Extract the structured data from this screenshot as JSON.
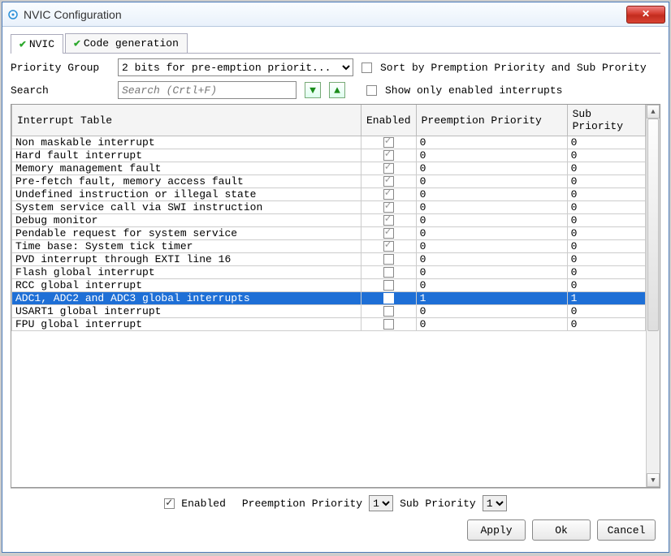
{
  "window": {
    "title": "NVIC Configuration"
  },
  "tabs": {
    "nvic": "NVIC",
    "codegen": "Code generation"
  },
  "priority_group": {
    "label": "Priority Group",
    "value": "2 bits for pre-emption priorit..."
  },
  "sort_checkbox": "Sort by Premption Priority and Sub Prority",
  "search": {
    "label": "Search",
    "placeholder": "Search (Crtl+F)"
  },
  "show_enabled": "Show only enabled interrupts",
  "columns": {
    "c0": "Interrupt Table",
    "c1": "Enabled",
    "c2": "Preemption Priority",
    "c3": "Sub Priority"
  },
  "rows": [
    {
      "name": "Non maskable interrupt",
      "en": true,
      "lock": true,
      "pre": "0",
      "sub": "0"
    },
    {
      "name": "Hard fault interrupt",
      "en": true,
      "lock": true,
      "pre": "0",
      "sub": "0"
    },
    {
      "name": "Memory management fault",
      "en": true,
      "lock": true,
      "pre": "0",
      "sub": "0"
    },
    {
      "name": "Pre-fetch fault, memory access fault",
      "en": true,
      "lock": true,
      "pre": "0",
      "sub": "0"
    },
    {
      "name": "Undefined instruction or illegal state",
      "en": true,
      "lock": true,
      "pre": "0",
      "sub": "0"
    },
    {
      "name": "System service call via SWI instruction",
      "en": true,
      "lock": true,
      "pre": "0",
      "sub": "0"
    },
    {
      "name": "Debug monitor",
      "en": true,
      "lock": true,
      "pre": "0",
      "sub": "0"
    },
    {
      "name": "Pendable request for system service",
      "en": true,
      "lock": true,
      "pre": "0",
      "sub": "0"
    },
    {
      "name": "Time base: System tick timer",
      "en": true,
      "lock": true,
      "pre": "0",
      "sub": "0"
    },
    {
      "name": "PVD interrupt through EXTI line 16",
      "en": false,
      "lock": false,
      "pre": "0",
      "sub": "0"
    },
    {
      "name": "Flash global interrupt",
      "en": false,
      "lock": false,
      "pre": "0",
      "sub": "0"
    },
    {
      "name": "RCC global interrupt",
      "en": false,
      "lock": false,
      "pre": "0",
      "sub": "0"
    },
    {
      "name": "ADC1, ADC2 and ADC3 global interrupts",
      "en": true,
      "lock": false,
      "pre": "1",
      "sub": "1",
      "selected": true
    },
    {
      "name": "USART1 global interrupt",
      "en": false,
      "lock": false,
      "pre": "0",
      "sub": "0"
    },
    {
      "name": "FPU global interrupt",
      "en": false,
      "lock": false,
      "pre": "0",
      "sub": "0"
    }
  ],
  "edit": {
    "enabled_label": "Enabled",
    "pre_label": "Preemption Priority",
    "sub_label": "Sub Priority",
    "pre_value": "1",
    "sub_value": "1"
  },
  "buttons": {
    "apply": "Apply",
    "ok": "Ok",
    "cancel": "Cancel"
  }
}
